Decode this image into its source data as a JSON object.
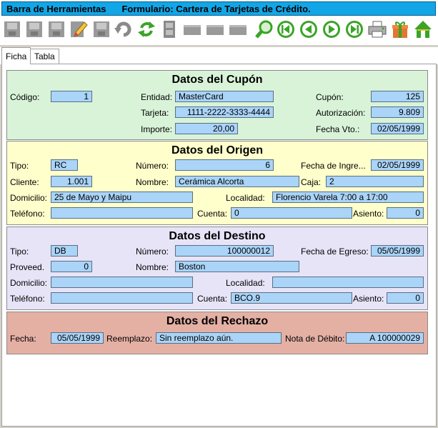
{
  "titlebar": {
    "toolbar_title": "Barra de Herramientas",
    "form_title": "Formulario: Cartera de Tarjetas de Crédito."
  },
  "toolbar": {
    "icons": [
      "new-icon",
      "delete-icon",
      "save-icon",
      "edit-icon",
      "copy-icon",
      "undo-icon",
      "refresh-icon",
      "film-icon",
      "blank-icon-1",
      "blank-icon-2",
      "blank-icon-3",
      "search-icon",
      "first-icon",
      "prev-icon",
      "next-icon",
      "last-icon",
      "print-icon",
      "gift-icon",
      "home-icon"
    ]
  },
  "tabs": [
    {
      "label": "Ficha"
    },
    {
      "label": "Tabla"
    }
  ],
  "cupon": {
    "title": "Datos del Cupón",
    "codigo_label": "Código:",
    "codigo": "1",
    "entidad_label": "Entidad:",
    "entidad": "MasterCard",
    "cupon_label": "Cupón:",
    "cupon": "125",
    "tarjeta_label": "Tarjeta:",
    "tarjeta": "1111-2222-3333-4444",
    "autorizacion_label": "Autorización:",
    "autorizacion": "9.809",
    "importe_label": "Importe:",
    "importe": "20,00",
    "fecha_vto_label": "Fecha Vto.:",
    "fecha_vto": "02/05/1999"
  },
  "origen": {
    "title": "Datos del Origen",
    "tipo_label": "Tipo:",
    "tipo": "RC",
    "numero_label": "Número:",
    "numero": "6",
    "fecha_ingreso_label": "Fecha de Ingre...",
    "fecha_ingreso": "02/05/1999",
    "cliente_label": "Cliente:",
    "cliente": "1.001",
    "nombre_label": "Nombre:",
    "nombre": "Cerámica Alcorta",
    "caja_label": "Caja:",
    "caja": "2",
    "domicilio_label": "Domicilio:",
    "domicilio": "25 de Mayo y Maipu",
    "localidad_label": "Localidad:",
    "localidad": "Florencio Varela 7:00 a 17:00",
    "telefono_label": "Teléfono:",
    "telefono": "",
    "cuenta_label": "Cuenta:",
    "cuenta": "0",
    "asiento_label": "Asiento:",
    "asiento": "0"
  },
  "destino": {
    "title": "Datos del Destino",
    "tipo_label": "Tipo:",
    "tipo": "DB",
    "numero_label": "Número:",
    "numero": "100000012",
    "fecha_egreso_label": "Fecha de Egreso:",
    "fecha_egreso": "05/05/1999",
    "proveed_label": "Proveed.",
    "proveed": "0",
    "nombre_label": "Nombre:",
    "nombre": "Boston",
    "domicilio_label": "Domicilio:",
    "domicilio": "",
    "localidad_label": "Localidad:",
    "localidad": "",
    "telefono_label": "Teléfono:",
    "telefono": "",
    "cuenta_label": "Cuenta:",
    "cuenta": "BCO.9",
    "asiento_label": "Asiento:",
    "asiento": "0"
  },
  "rechazo": {
    "title": "Datos del Rechazo",
    "fecha_label": "Fecha:",
    "fecha": "05/05/1999",
    "reemplazo_label": "Reemplazo:",
    "reemplazo": "Sin reemplazo aún.",
    "nota_debito_label": "Nota de Débito:",
    "nota_debito": "A   100000029"
  },
  "colors": {
    "titlebar": "#12a6e6",
    "field": "#aad4f8",
    "cupon_bg": "#d9f3d9",
    "origen_bg": "#ffffcc",
    "destino_bg": "#e8e4f8",
    "rechazo_bg": "#e4b0a4",
    "nav_green": "#3aa428"
  }
}
